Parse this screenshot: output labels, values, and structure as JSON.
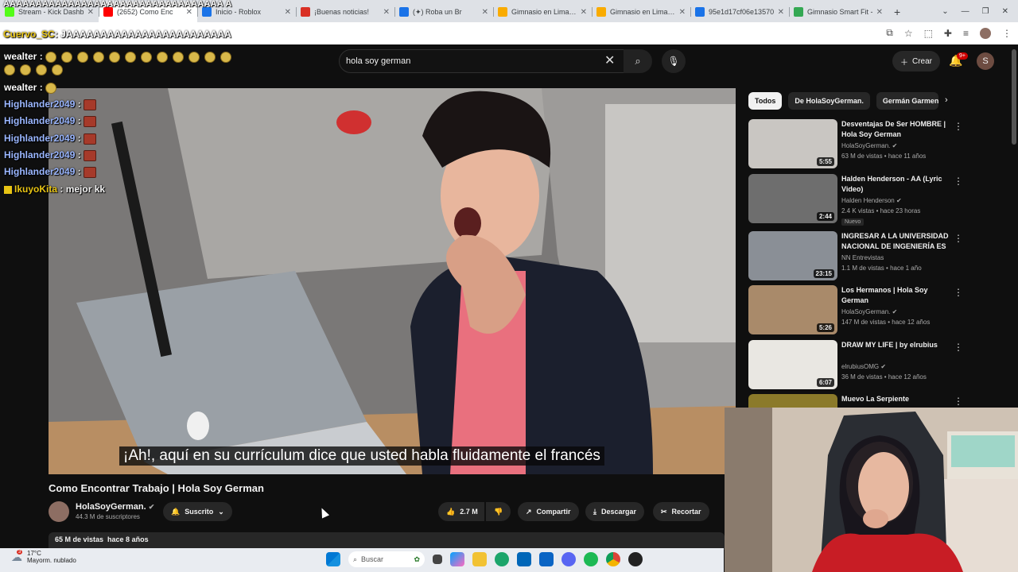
{
  "browser": {
    "tabs": [
      {
        "title": "Stream - Kick Dashb",
        "color": "#53fc18"
      },
      {
        "title": "(2652) Como Enc",
        "color": "#ff0000"
      },
      {
        "title": "Inicio - Roblox",
        "color": "#1a73e8"
      },
      {
        "title": "¡Buenas noticias!",
        "color": "#d93025"
      },
      {
        "title": "(✦) Roba un Br",
        "color": "#1a73e8"
      },
      {
        "title": "Gimnasio en Lima, Lu",
        "color": "#f9ab00"
      },
      {
        "title": "Gimnasio en Lima, Li",
        "color": "#f9ab00"
      },
      {
        "title": "95e1d17cf06e13570",
        "color": "#1a73e8"
      },
      {
        "title": "Gimnasio Smart Fit -",
        "color": "#34a853"
      }
    ],
    "new_tab": "+",
    "window_controls": [
      "⌄",
      "—",
      "❐",
      "✕"
    ]
  },
  "overlay": {
    "spam_text": "AAAAAAAAAAAAAAAAAAAAAAAAAAAAAAAAAA A",
    "top_user": "Cuervo_SC",
    "top_message": ": JAAAAAAAAAAAAAAAAAAAAAAAA"
  },
  "chat": [
    {
      "user": "wealter",
      "sep": ":",
      "message": "",
      "style": "white",
      "emotes": 23
    },
    {
      "user": "wealter",
      "sep": ":",
      "message": "",
      "style": "white",
      "emotes": 1
    },
    {
      "user": "Highlander2049",
      "sep": ":",
      "message": "",
      "style": "hl",
      "emotes": 1
    },
    {
      "user": "Highlander2049",
      "sep": ":",
      "message": "",
      "style": "hl",
      "emotes": 1
    },
    {
      "user": "Highlander2049",
      "sep": ":",
      "message": "",
      "style": "hl",
      "emotes": 1
    },
    {
      "user": "Highlander2049",
      "sep": ":",
      "message": "",
      "style": "hl",
      "emotes": 1
    },
    {
      "user": "Highlander2049",
      "sep": ":",
      "message": "",
      "style": "hl",
      "emotes": 1
    },
    {
      "user": "IkuyoKita",
      "sep": ":",
      "message": "mejor kk",
      "style": "gold",
      "emotes": 0
    }
  ],
  "youtube": {
    "search_value": "hola soy german",
    "create_label": "Crear",
    "notif_count": "9+",
    "user_initial": "S",
    "video_title": "Como Encontrar Trabajo | Hola Soy German",
    "subtitle": "¡Ah!, aquí en su currículum dice que usted habla fluidamente el francés",
    "channel": "HolaSoyGerman.",
    "subscribers": "44.3 M de suscriptores",
    "subscribed_label": "Suscrito",
    "likes": "2.7 M",
    "share_label": "Compartir",
    "download_label": "Descargar",
    "clip_label": "Recortar",
    "meta_views": "65 M de vistas",
    "meta_date": "hace 8 años",
    "chips": [
      "Todos",
      "De HolaSoyGerman.",
      "Germán Garmen"
    ],
    "recommended": [
      {
        "title": "Desventajas De Ser HOMBRE | Hola Soy German",
        "channel": "HolaSoyGerman.",
        "verified": true,
        "views": "63 M de vistas",
        "age": "hace 11 años",
        "duration": "5:55",
        "badge": "",
        "thumb_color": "#c9c6c2"
      },
      {
        "title": "Halden Henderson - AA (Lyric Video)",
        "channel": "Halden Henderson",
        "verified": true,
        "views": "2.4 K vistas",
        "age": "hace 23 horas",
        "duration": "2:44",
        "badge": "Nuevo",
        "thumb_color": "#6e6e6e"
      },
      {
        "title": "INGRESAR A LA UNIVERSIDAD NACIONAL DE INGENIERÍA ES ...",
        "channel": "NN Entrevistas",
        "verified": false,
        "views": "1.1 M de vistas",
        "age": "hace 1 año",
        "duration": "23:15",
        "badge": "",
        "thumb_color": "#8a8f96"
      },
      {
        "title": "Los Hermanos | Hola Soy German",
        "channel": "HolaSoyGerman.",
        "verified": true,
        "views": "147 M de vistas",
        "age": "hace 12 años",
        "duration": "5:26",
        "badge": "",
        "thumb_color": "#a98a6a"
      },
      {
        "title": "DRAW MY LIFE | by elrubius",
        "channel": "elrubiusOMG",
        "verified": true,
        "views": "36 M de vistas",
        "age": "hace 12 años",
        "duration": "6:07",
        "badge": "",
        "thumb_color": "#e9e7e2"
      },
      {
        "title": "Muevo La Serpiente",
        "channel": "",
        "verified": false,
        "views": "",
        "age": "",
        "duration": "",
        "badge": "",
        "thumb_color": "#8b7a2a"
      }
    ]
  },
  "taskbar": {
    "temperature": "17°C",
    "weather_desc": "Mayorm. nublado",
    "search_placeholder": "Buscar",
    "notif_badge": "3"
  }
}
